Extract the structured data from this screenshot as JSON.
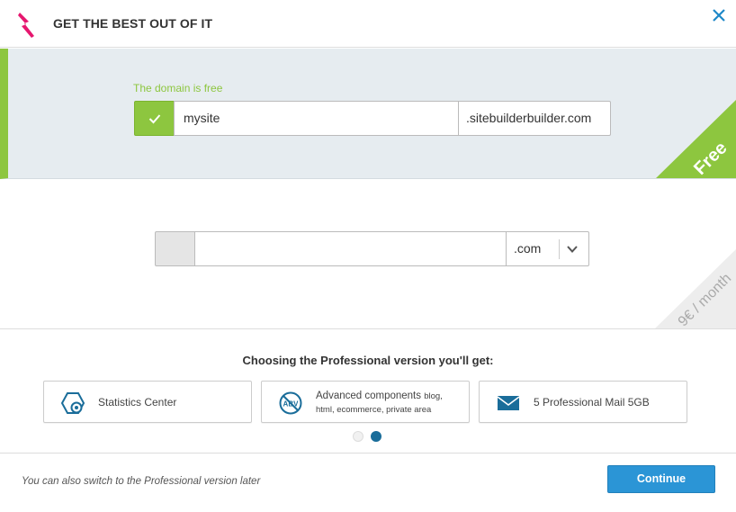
{
  "header": {
    "title": "GET THE BEST OUT OF IT",
    "logo_icon": "lightning-bolt-icon",
    "close_icon": "close-icon",
    "brand_color": "#e6176f",
    "close_color": "#1e88c8"
  },
  "free_domain": {
    "status_text": "The domain is free",
    "subdomain_value": "mysite",
    "suffix": ".sitebuilderbuilder.com",
    "corner_label": "Free",
    "accent_color": "#8dc63f",
    "check_icon": "check-icon"
  },
  "pro_domain": {
    "input_value": "",
    "tld_selected": ".com",
    "corner_label": "9€ / month",
    "dropdown_icon": "chevron-down-icon"
  },
  "benefits": {
    "title": "Choosing the Professional version you'll get:",
    "cards": [
      {
        "icon": "statistics-icon",
        "label": "Statistics Center"
      },
      {
        "icon": "abv-components-icon",
        "label": "Advanced components",
        "label_extra": "blog,",
        "sub_label": "html, ecommerce, private area"
      },
      {
        "icon": "mail-icon",
        "label": "5 Professional Mail 5GB"
      }
    ],
    "carousel": {
      "total": 2,
      "active": 2
    }
  },
  "footer": {
    "note": "You can also switch to the Professional version later",
    "continue_label": "Continue",
    "button_color": "#2b95d6"
  }
}
